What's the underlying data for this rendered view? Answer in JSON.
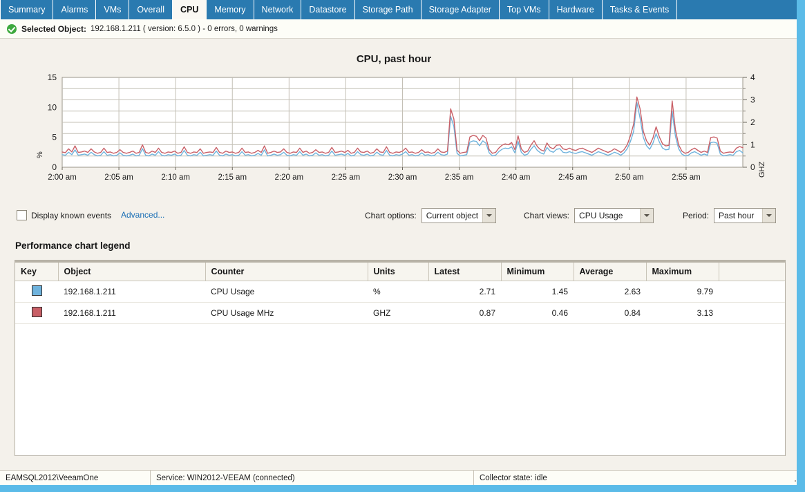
{
  "tabs": [
    {
      "label": "Summary",
      "active": false
    },
    {
      "label": "Alarms",
      "active": false
    },
    {
      "label": "VMs",
      "active": false
    },
    {
      "label": "Overall",
      "active": false
    },
    {
      "label": "CPU",
      "active": true
    },
    {
      "label": "Memory",
      "active": false
    },
    {
      "label": "Network",
      "active": false
    },
    {
      "label": "Datastore",
      "active": false
    },
    {
      "label": "Storage Path",
      "active": false
    },
    {
      "label": "Storage Adapter",
      "active": false
    },
    {
      "label": "Top VMs",
      "active": false
    },
    {
      "label": "Hardware",
      "active": false
    },
    {
      "label": "Tasks & Events",
      "active": false
    }
  ],
  "selected_object": {
    "label": "Selected Object:",
    "value": "192.168.1.211 ( version: 6.5.0 ) - 0 errors, 0 warnings",
    "status_icon": "green-check-icon"
  },
  "options": {
    "display_known_events_label": "Display known events",
    "display_known_events_checked": false,
    "advanced_label": "Advanced...",
    "chart_options_label": "Chart options:",
    "chart_options_value": "Current object",
    "chart_views_label": "Chart views:",
    "chart_views_value": "CPU Usage",
    "period_label": "Period:",
    "period_value": "Past hour"
  },
  "legend": {
    "title": "Performance chart legend",
    "columns": [
      "Key",
      "Object",
      "Counter",
      "Units",
      "Latest",
      "Minimum",
      "Average",
      "Maximum",
      ""
    ],
    "rows": [
      {
        "color": "#6fb3dd",
        "object": "192.168.1.211",
        "counter": "CPU Usage",
        "units": "%",
        "latest": "2.71",
        "minimum": "1.45",
        "average": "2.63",
        "maximum": "9.79"
      },
      {
        "color": "#c95f66",
        "object": "192.168.1.211",
        "counter": "CPU Usage MHz",
        "units": "GHZ",
        "latest": "0.87",
        "minimum": "0.46",
        "average": "0.84",
        "maximum": "3.13"
      }
    ]
  },
  "statusbar": {
    "database": "EAMSQL2012\\VeeamOne",
    "service": "Service: WIN2012-VEEAM (connected)",
    "collector": "Collector state:  idle"
  },
  "chart_data": {
    "type": "line",
    "title": "CPU, past hour",
    "xlabel": "",
    "ylabel": "%",
    "y2label": "GHZ",
    "ylim": [
      0,
      15
    ],
    "y2lim": [
      0,
      4
    ],
    "yticks": [
      0,
      5,
      10,
      15
    ],
    "y2ticks": [
      0,
      1,
      2,
      3,
      4
    ],
    "grid": true,
    "legend_position": "table-below",
    "xtick_labels": [
      "2:00 am",
      "2:05 am",
      "2:10 am",
      "2:15 am",
      "2:20 am",
      "2:25 am",
      "2:30 am",
      "2:35 am",
      "2:40 am",
      "2:45 am",
      "2:50 am",
      "2:55 am"
    ],
    "series": [
      {
        "name": "CPU Usage",
        "unit": "%",
        "color": "#6fb3dd",
        "axis": "left",
        "values": [
          2.1,
          2.0,
          2.5,
          2.1,
          2.9,
          2.0,
          2.1,
          2.2,
          2.0,
          2.5,
          2.1,
          1.9,
          2.0,
          2.6,
          2.0,
          2.1,
          1.9,
          2.0,
          2.4,
          2.0,
          1.9,
          2.0,
          2.2,
          1.9,
          2.0,
          3.1,
          2.0,
          1.9,
          2.2,
          2.0,
          2.6,
          2.0,
          1.9,
          2.1,
          2.0,
          2.2,
          1.9,
          2.0,
          2.8,
          2.0,
          1.9,
          2.1,
          2.0,
          2.5,
          1.9,
          2.0,
          2.1,
          2.0,
          2.7,
          2.0,
          1.9,
          2.2,
          2.0,
          2.1,
          1.9,
          2.0,
          2.6,
          2.0,
          2.1,
          1.9,
          2.0,
          2.3,
          2.0,
          2.9,
          1.9,
          2.0,
          2.2,
          2.0,
          2.1,
          2.5,
          2.0,
          1.9,
          2.1,
          2.0,
          2.6,
          2.0,
          2.2,
          1.9,
          2.0,
          2.4,
          2.0,
          2.1,
          1.9,
          2.0,
          2.7,
          2.0,
          2.1,
          2.2,
          2.0,
          2.3,
          1.9,
          2.0,
          2.6,
          2.1,
          2.0,
          2.2,
          1.9,
          2.0,
          2.5,
          2.1,
          2.0,
          2.8,
          2.0,
          1.9,
          2.1,
          2.0,
          2.2,
          2.6,
          2.0,
          2.1,
          1.9,
          2.0,
          2.4,
          2.0,
          2.1,
          1.9,
          2.0,
          2.5,
          2.1,
          2.0,
          2.2,
          8.5,
          6.8,
          2.3,
          1.9,
          2.0,
          2.1,
          4.2,
          4.4,
          4.3,
          3.6,
          4.4,
          4.0,
          2.4,
          1.9,
          2.0,
          2.6,
          3.0,
          3.2,
          3.1,
          3.4,
          2.4,
          4.3,
          2.5,
          2.0,
          2.2,
          3.0,
          3.6,
          2.8,
          2.4,
          2.2,
          3.3,
          2.7,
          2.5,
          3.0,
          3.1,
          2.5,
          2.4,
          2.6,
          2.4,
          2.3,
          2.5,
          2.6,
          2.4,
          2.2,
          2.0,
          2.3,
          2.6,
          2.4,
          2.2,
          2.0,
          2.2,
          2.5,
          2.3,
          2.0,
          2.4,
          3.1,
          4.3,
          6.0,
          10.8,
          8.2,
          5.0,
          3.6,
          3.0,
          4.0,
          5.6,
          4.2,
          3.2,
          2.9,
          3.0,
          9.3,
          5.2,
          3.1,
          2.2,
          1.9,
          2.0,
          2.4,
          2.6,
          2.3,
          2.0,
          2.2,
          2.0,
          4.1,
          4.2,
          4.0,
          2.2,
          1.9,
          2.0,
          2.1,
          2.0,
          2.6,
          2.8,
          2.4
        ]
      },
      {
        "name": "CPU Usage MHz",
        "unit": "GHZ",
        "color": "#c95f66",
        "axis": "right",
        "values": [
          0.68,
          0.65,
          0.82,
          0.68,
          0.95,
          0.66,
          0.68,
          0.72,
          0.66,
          0.82,
          0.68,
          0.62,
          0.66,
          0.85,
          0.66,
          0.68,
          0.62,
          0.66,
          0.78,
          0.66,
          0.62,
          0.66,
          0.72,
          0.62,
          0.66,
          1.0,
          0.66,
          0.62,
          0.72,
          0.66,
          0.85,
          0.66,
          0.62,
          0.68,
          0.66,
          0.72,
          0.62,
          0.66,
          0.91,
          0.66,
          0.62,
          0.68,
          0.66,
          0.82,
          0.62,
          0.66,
          0.68,
          0.66,
          0.88,
          0.66,
          0.62,
          0.72,
          0.66,
          0.68,
          0.62,
          0.66,
          0.85,
          0.66,
          0.68,
          0.62,
          0.66,
          0.75,
          0.66,
          0.95,
          0.62,
          0.66,
          0.72,
          0.66,
          0.68,
          0.82,
          0.66,
          0.62,
          0.68,
          0.66,
          0.85,
          0.66,
          0.72,
          0.62,
          0.66,
          0.78,
          0.66,
          0.68,
          0.62,
          0.66,
          0.88,
          0.66,
          0.68,
          0.72,
          0.66,
          0.75,
          0.62,
          0.66,
          0.85,
          0.68,
          0.66,
          0.72,
          0.62,
          0.66,
          0.82,
          0.68,
          0.66,
          0.91,
          0.66,
          0.62,
          0.68,
          0.66,
          0.72,
          0.85,
          0.66,
          0.68,
          0.62,
          0.66,
          0.78,
          0.66,
          0.68,
          0.62,
          0.66,
          0.82,
          0.68,
          0.66,
          0.72,
          2.6,
          2.15,
          0.76,
          0.62,
          0.66,
          0.68,
          1.35,
          1.42,
          1.38,
          1.18,
          1.42,
          1.3,
          0.78,
          0.62,
          0.66,
          0.85,
          0.98,
          1.04,
          1.0,
          1.1,
          0.78,
          1.4,
          0.82,
          0.66,
          0.72,
          0.98,
          1.18,
          0.92,
          0.78,
          0.72,
          1.08,
          0.88,
          0.82,
          0.98,
          1.0,
          0.82,
          0.78,
          0.85,
          0.78,
          0.75,
          0.82,
          0.85,
          0.78,
          0.72,
          0.66,
          0.75,
          0.85,
          0.78,
          0.72,
          0.66,
          0.72,
          0.82,
          0.75,
          0.66,
          0.78,
          1.0,
          1.4,
          1.92,
          3.13,
          2.6,
          1.6,
          1.18,
          0.98,
          1.3,
          1.8,
          1.35,
          1.04,
          0.95,
          0.98,
          2.95,
          1.68,
          1.0,
          0.72,
          0.62,
          0.66,
          0.78,
          0.85,
          0.75,
          0.66,
          0.72,
          0.66,
          1.32,
          1.35,
          1.3,
          0.72,
          0.62,
          0.66,
          0.68,
          0.66,
          0.85,
          0.92,
          0.87
        ]
      }
    ]
  }
}
